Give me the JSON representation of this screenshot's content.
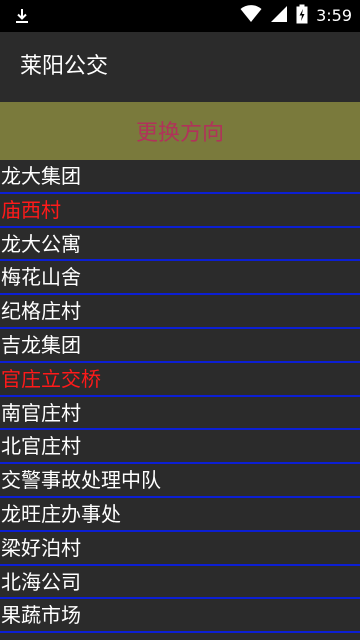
{
  "status_bar": {
    "left_icon": "download-icon",
    "right_icons": [
      "wifi-icon",
      "cell-signal-icon",
      "battery-icon"
    ],
    "time": "3:59"
  },
  "app_bar": {
    "title": "莱阳公交"
  },
  "direction_button": {
    "label": "更换方向",
    "background": "#7a7a3c",
    "text_color": "#b0335a"
  },
  "stops": [
    {
      "name": "龙大集团",
      "highlight": false
    },
    {
      "name": "庙西村",
      "highlight": true
    },
    {
      "name": "龙大公寓",
      "highlight": false
    },
    {
      "name": "梅花山舍",
      "highlight": false
    },
    {
      "name": "纪格庄村",
      "highlight": false
    },
    {
      "name": "吉龙集团",
      "highlight": false
    },
    {
      "name": "官庄立交桥",
      "highlight": true
    },
    {
      "name": "南官庄村",
      "highlight": false
    },
    {
      "name": "北官庄村",
      "highlight": false
    },
    {
      "name": "交警事故处理中队",
      "highlight": false
    },
    {
      "name": "龙旺庄办事处",
      "highlight": false
    },
    {
      "name": "梁好泊村",
      "highlight": false
    },
    {
      "name": "北海公司",
      "highlight": false
    },
    {
      "name": "果蔬市场",
      "highlight": false
    }
  ],
  "colors": {
    "divider": "#0c1fd4",
    "highlight_text": "#ff1a1a",
    "normal_text": "#ffffff",
    "background": "#2b2b2b"
  }
}
